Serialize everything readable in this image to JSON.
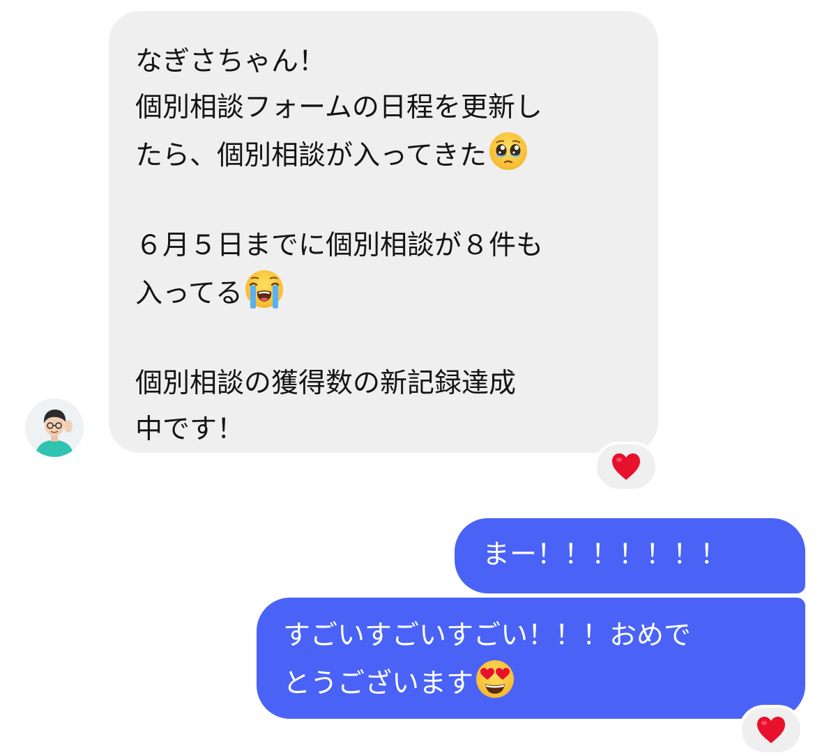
{
  "incoming": {
    "lines": [
      "なぎさちゃん！",
      "個別相談フォームの日程を更新し",
      "たら、個別相談が入ってきた",
      "",
      "６月５日までに個別相談が８件も",
      "入ってる",
      "",
      "個別相談の獲得数の新記録達成",
      "中です！"
    ],
    "emoji_1": "pleading-face-emoji",
    "emoji_2": "loudly-crying-face-emoji",
    "reaction": "heart"
  },
  "outgoing": [
    {
      "lines": [
        "まー！！！！！！！"
      ]
    },
    {
      "lines": [
        "すごいすごいすごい！！！おめで",
        "とうございます"
      ],
      "emoji": "heart-eyes-emoji",
      "reaction": "heart"
    }
  ],
  "colors": {
    "incoming_bubble": "#efeff0",
    "outgoing_bubble": "#4a63f6",
    "heart": "#e8112d",
    "avatar_shirt": "#2fc3b0"
  }
}
